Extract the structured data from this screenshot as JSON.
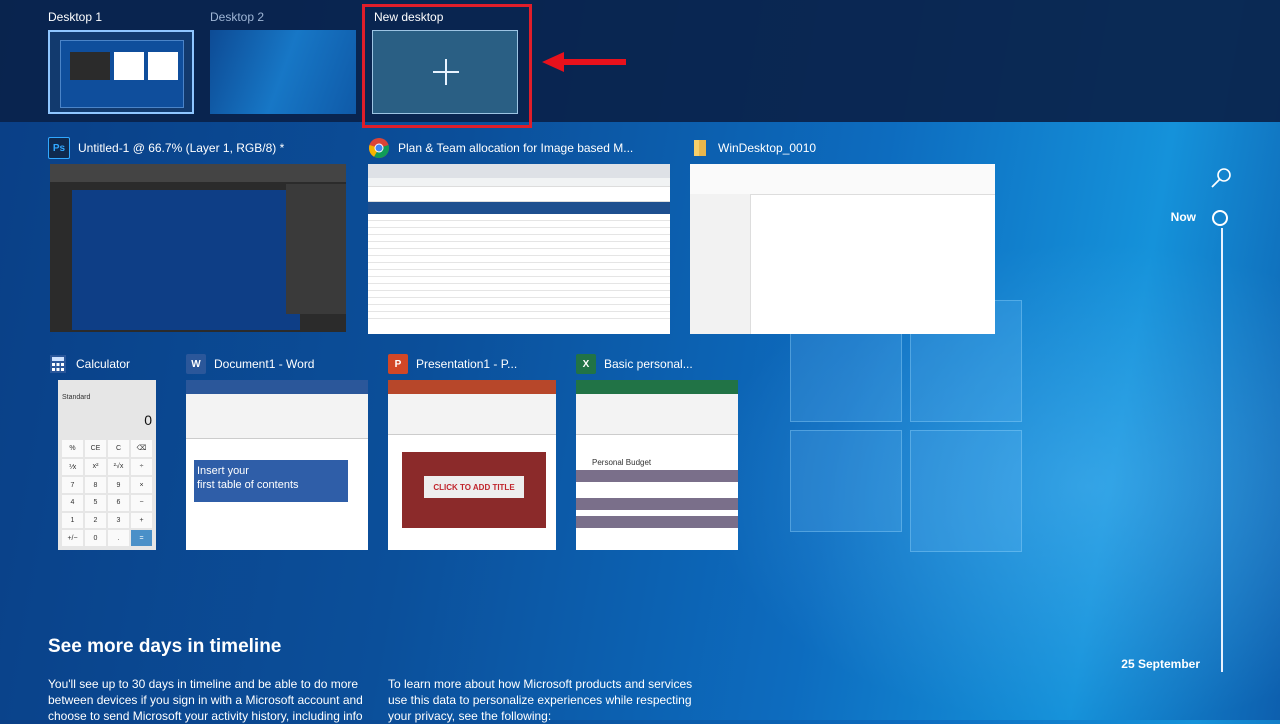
{
  "desktops": [
    {
      "label": "Desktop 1",
      "active": true
    },
    {
      "label": "Desktop 2",
      "active": false
    },
    {
      "label": "New desktop",
      "active": false
    }
  ],
  "windows": [
    {
      "title": "Untitled-1 @ 66.7% (Layer 1, RGB/8) *",
      "app": "Photoshop",
      "icon": "Ps"
    },
    {
      "title": "Plan & Team allocation for Image based M...",
      "app": "Chrome"
    },
    {
      "title": "WinDesktop_0010",
      "app": "File Explorer"
    },
    {
      "title": "Calculator",
      "app": "Calculator"
    },
    {
      "title": "Document1 - Word",
      "app": "Word",
      "icon": "W"
    },
    {
      "title": "Presentation1 - P...",
      "app": "PowerPoint",
      "icon": "P"
    },
    {
      "title": "Basic personal...",
      "app": "Excel",
      "icon": "X"
    }
  ],
  "thumb_text": {
    "calc_mode": "Standard",
    "calc_display": "0",
    "calc_keys": [
      "%",
      "CE",
      "C",
      "⌫",
      "⅟x",
      "x²",
      "²√x",
      "÷",
      "7",
      "8",
      "9",
      "×",
      "4",
      "5",
      "6",
      "−",
      "1",
      "2",
      "3",
      "+",
      "+/−",
      "0",
      ".",
      "="
    ],
    "word_banner_1": "Insert your",
    "word_banner_2": "first table of contents",
    "ppt_title": "CLICK TO ADD TITLE",
    "xl_title": "Personal Budget"
  },
  "timeline": {
    "now_label": "Now",
    "date_label": "25 September"
  },
  "info": {
    "title": "See more days in timeline",
    "text_left": "You'll see up to 30 days in timeline and be able to do more between devices if you sign in with a Microsoft account and choose to send Microsoft your activity history, including info",
    "text_right": "To learn more about how Microsoft products and services use this data to personalize experiences while respecting your privacy, see the following:"
  },
  "colors": {
    "highlight": "#e01e2a",
    "photoshop": "#0f2a4f",
    "word": "#2b579a",
    "powerpoint": "#d24726",
    "excel": "#217346"
  }
}
